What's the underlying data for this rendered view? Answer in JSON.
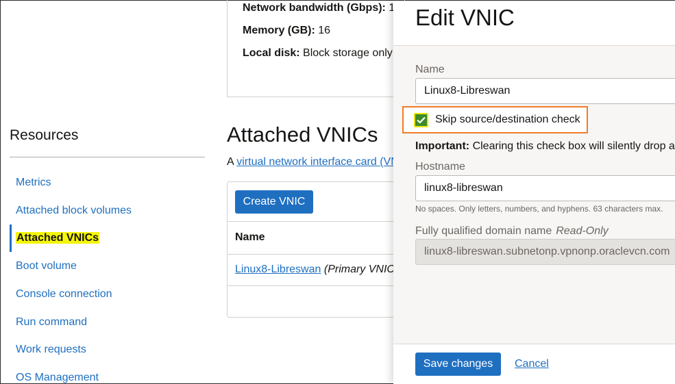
{
  "details": {
    "network_bandwidth_label": "Network bandwidth (Gbps):",
    "network_bandwidth_value": "1",
    "memory_label": "Memory (GB):",
    "memory_value": "16",
    "local_disk_label": "Local disk:",
    "local_disk_value": "Block storage only"
  },
  "sidebar": {
    "title": "Resources",
    "items": [
      {
        "label": "Metrics"
      },
      {
        "label": "Attached block volumes"
      },
      {
        "label": "Attached VNICs",
        "active": true
      },
      {
        "label": "Boot volume"
      },
      {
        "label": "Console connection"
      },
      {
        "label": "Run command"
      },
      {
        "label": "Work requests"
      },
      {
        "label": "OS Management"
      }
    ]
  },
  "vnics_section": {
    "title": "Attached VNICs",
    "desc_prefix": "A ",
    "desc_link": "virtual network interface card (VN",
    "create_button": "Create VNIC",
    "column_name": "Name",
    "rows": [
      {
        "name": "Linux8-Libreswan",
        "note": "(Primary VNIC"
      }
    ]
  },
  "edit_panel": {
    "title": "Edit VNIC",
    "name_label": "Name",
    "name_value": "Linux8-Libreswan",
    "skip_check_label": "Skip source/destination check",
    "skip_check_checked": true,
    "important_label": "Important:",
    "important_text": "Clearing this check box will silently drop a",
    "hostname_label": "Hostname",
    "hostname_value": "linux8-libreswan",
    "hostname_help": "No spaces. Only letters, numbers, and hyphens. 63 characters max.",
    "fqdn_label": "Fully qualified domain name",
    "fqdn_readonly": "Read-Only",
    "fqdn_value": "linux8-libreswan.subnetonp.vpnonp.oraclevcn.com",
    "save_button": "Save changes",
    "cancel_link": "Cancel"
  },
  "colors": {
    "accent": "#1f6fc1",
    "highlight": "#f5f50a",
    "focus_outline": "#f07c26",
    "checkbox": "#3d8a2a"
  },
  "icons": {
    "checkbox": "checkmark-icon"
  }
}
